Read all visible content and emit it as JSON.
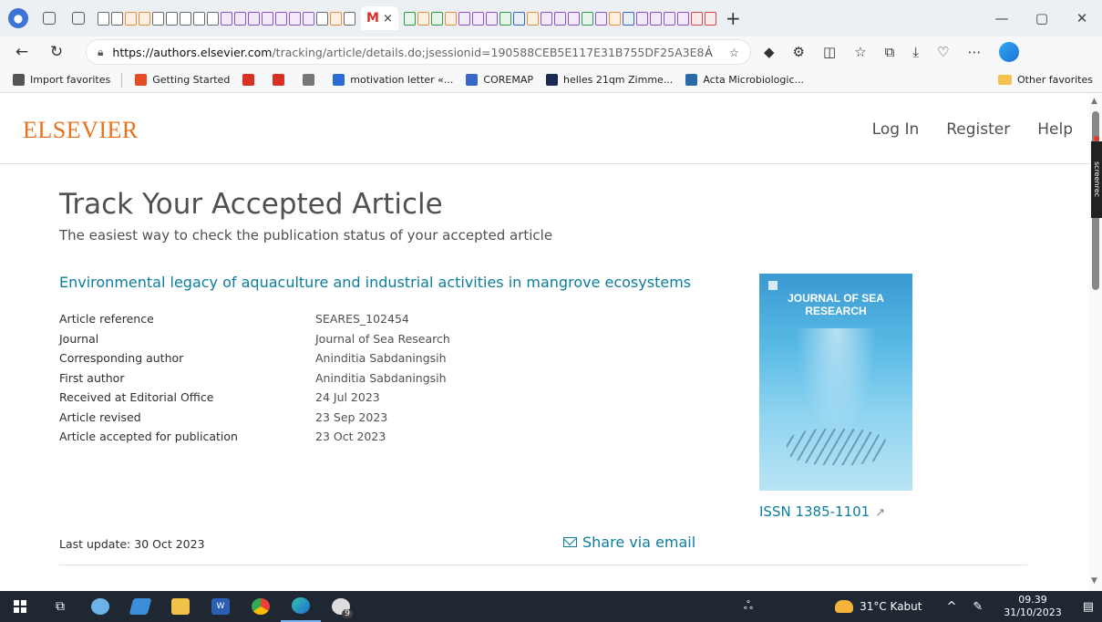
{
  "browser": {
    "profile_icon": "profile-avatar-icon",
    "active_tab_close": "×",
    "new_tab": "+",
    "window_controls": {
      "minimize": "—",
      "maximize": "▢",
      "close": "✕"
    },
    "address": {
      "domain": "https://authors.elsevier.com",
      "path": "/tracking/article/details.do;jsessionid=190588CEB5E117E31B755DF25A3E8...",
      "read_aloud": "A̒",
      "favorite_star": "☆"
    },
    "favorites": [
      {
        "label": "Import favorites",
        "color": "#555555"
      },
      {
        "label": "Getting Started",
        "color": "#e34c26"
      },
      {
        "label": "",
        "color": "#d93025"
      },
      {
        "label": "",
        "color": "#d93025"
      },
      {
        "label": "",
        "color": "#777777"
      },
      {
        "label": "motivation letter «...",
        "color": "#2a6bd6"
      },
      {
        "label": "COREMAP",
        "color": "#3a66c8"
      },
      {
        "label": "helles 21qm Zimme...",
        "color": "#1b2a52"
      },
      {
        "label": "Acta Microbiologic...",
        "color": "#2b6aa8"
      }
    ],
    "other_favorites": "Other favorites"
  },
  "site": {
    "logo": "ELSEVIER",
    "nav": {
      "login": "Log In",
      "register": "Register",
      "help": "Help"
    },
    "title": "Track Your Accepted Article",
    "subtitle": "The easiest way to check the publication status of your accepted article",
    "article_title": "Environmental legacy of aquaculture and industrial activities in mangrove ecosystems",
    "details": [
      {
        "label": "Article reference",
        "value": "SEARES_102454"
      },
      {
        "label": "Journal",
        "value": "Journal of Sea Research"
      },
      {
        "label": "Corresponding author",
        "value": "Aninditia Sabdaningsih"
      },
      {
        "label": "First author",
        "value": "Aninditia Sabdaningsih"
      },
      {
        "label": "Received at Editorial Office",
        "value": "24 Jul 2023"
      },
      {
        "label": "Article revised",
        "value": "23 Sep 2023"
      },
      {
        "label": "Article accepted for publication",
        "value": "23 Oct 2023"
      }
    ],
    "cover_title": "JOURNAL OF SEA RESEARCH",
    "issn": "ISSN 1385-1101",
    "issn_ext_icon": "↗",
    "last_update": "Last update:  30 Oct 2023",
    "share": "Share via email"
  },
  "screenrec_label": "screenrec",
  "taskbar": {
    "weather": "31°C  Kabut",
    "time": "09.39",
    "date": "31/10/2023",
    "whatsapp_badge": "9"
  }
}
